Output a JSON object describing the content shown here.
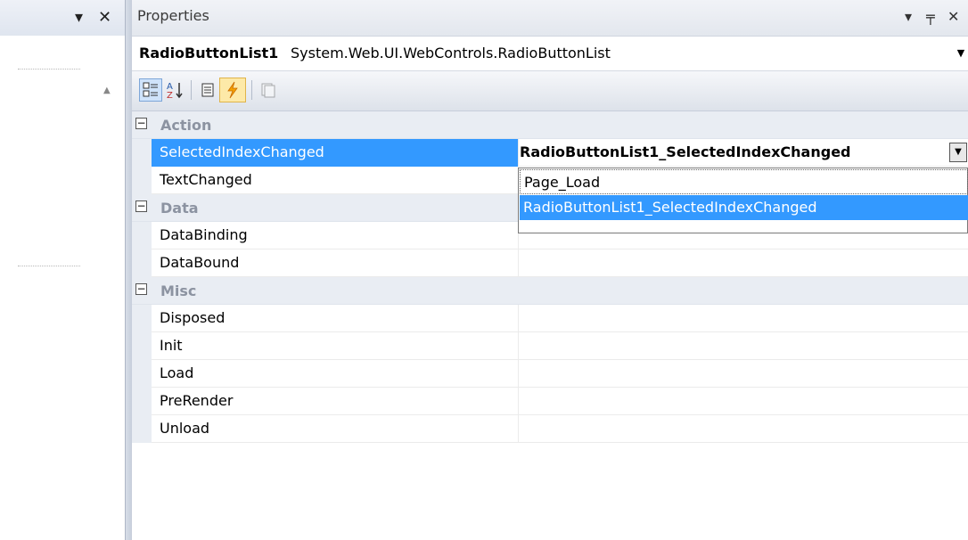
{
  "left_panel": {
    "dropdown_glyph": "▾",
    "close_glyph": "✕"
  },
  "properties": {
    "title": "Properties",
    "pin_glyph": "ꟷ",
    "object_name": "RadioButtonList1",
    "object_type": "System.Web.UI.WebControls.RadioButtonList",
    "toolbar": {
      "categorized_icon": "categorized-icon",
      "alphabetical_icon": "alphabetical-icon",
      "properties_icon": "properties-icon",
      "events_icon": "lightning-bolt-icon",
      "property_pages_icon": "property-pages-icon"
    },
    "categories": [
      {
        "label": "Action",
        "expander": "⊟",
        "items": [
          {
            "name": "SelectedIndexChanged",
            "value": "RadioButtonList1_SelectedIndexChanged"
          },
          {
            "name": "TextChanged",
            "value": ""
          }
        ]
      },
      {
        "label": "Data",
        "expander": "⊟",
        "items": [
          {
            "name": "DataBinding",
            "value": ""
          },
          {
            "name": "DataBound",
            "value": ""
          }
        ]
      },
      {
        "label": "Misc",
        "expander": "⊟",
        "items": [
          {
            "name": "Disposed",
            "value": ""
          },
          {
            "name": "Init",
            "value": ""
          },
          {
            "name": "Load",
            "value": ""
          },
          {
            "name": "PreRender",
            "value": ""
          },
          {
            "name": "Unload",
            "value": ""
          }
        ]
      }
    ],
    "dropdown_options": [
      "Page_Load",
      "RadioButtonList1_SelectedIndexChanged"
    ],
    "selected_color": "#3399ff",
    "highlight_color": "#e00000"
  }
}
